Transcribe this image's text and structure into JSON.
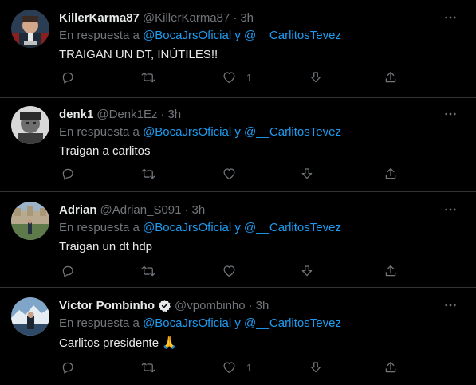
{
  "tweets": [
    {
      "name": "KillerKarma87",
      "handle": "@KillerKarma87",
      "time": "3h",
      "reply_prefix": "En respuesta a",
      "mention1": "@BocaJrsOficial",
      "reply_and": "y",
      "mention2": "@__CarlitosTevez",
      "text": "TRAIGAN UN DT, INÚTILES!!",
      "like_count": "1",
      "verified": false
    },
    {
      "name": "denk1",
      "handle": "@Denk1Ez",
      "time": "3h",
      "reply_prefix": "En respuesta a",
      "mention1": "@BocaJrsOficial",
      "reply_and": "y",
      "mention2": "@__CarlitosTevez",
      "text": "Traigan a carlitos",
      "like_count": "",
      "verified": false
    },
    {
      "name": "Adrian",
      "handle": "@Adrian_S091",
      "time": "3h",
      "reply_prefix": "En respuesta a",
      "mention1": "@BocaJrsOficial",
      "reply_and": "y",
      "mention2": "@__CarlitosTevez",
      "text": "Traigan un dt hdp",
      "like_count": "",
      "verified": false
    },
    {
      "name": "Víctor Pombinho",
      "handle": "@vpombinho",
      "time": "3h",
      "reply_prefix": "En respuesta a",
      "mention1": "@BocaJrsOficial",
      "reply_and": "y",
      "mention2": "@__CarlitosTevez",
      "text": "Carlitos presidente 🙏",
      "like_count": "1",
      "verified": true
    }
  ],
  "colors": {
    "background": "#000000",
    "text": "#e7e9ea",
    "muted": "#71767b",
    "link": "#1d9bf0",
    "border": "#2f3336"
  },
  "icons": [
    "more-icon",
    "reply-icon",
    "retweet-icon",
    "like-icon",
    "share-down-icon",
    "share-up-icon",
    "verified-badge-icon"
  ]
}
